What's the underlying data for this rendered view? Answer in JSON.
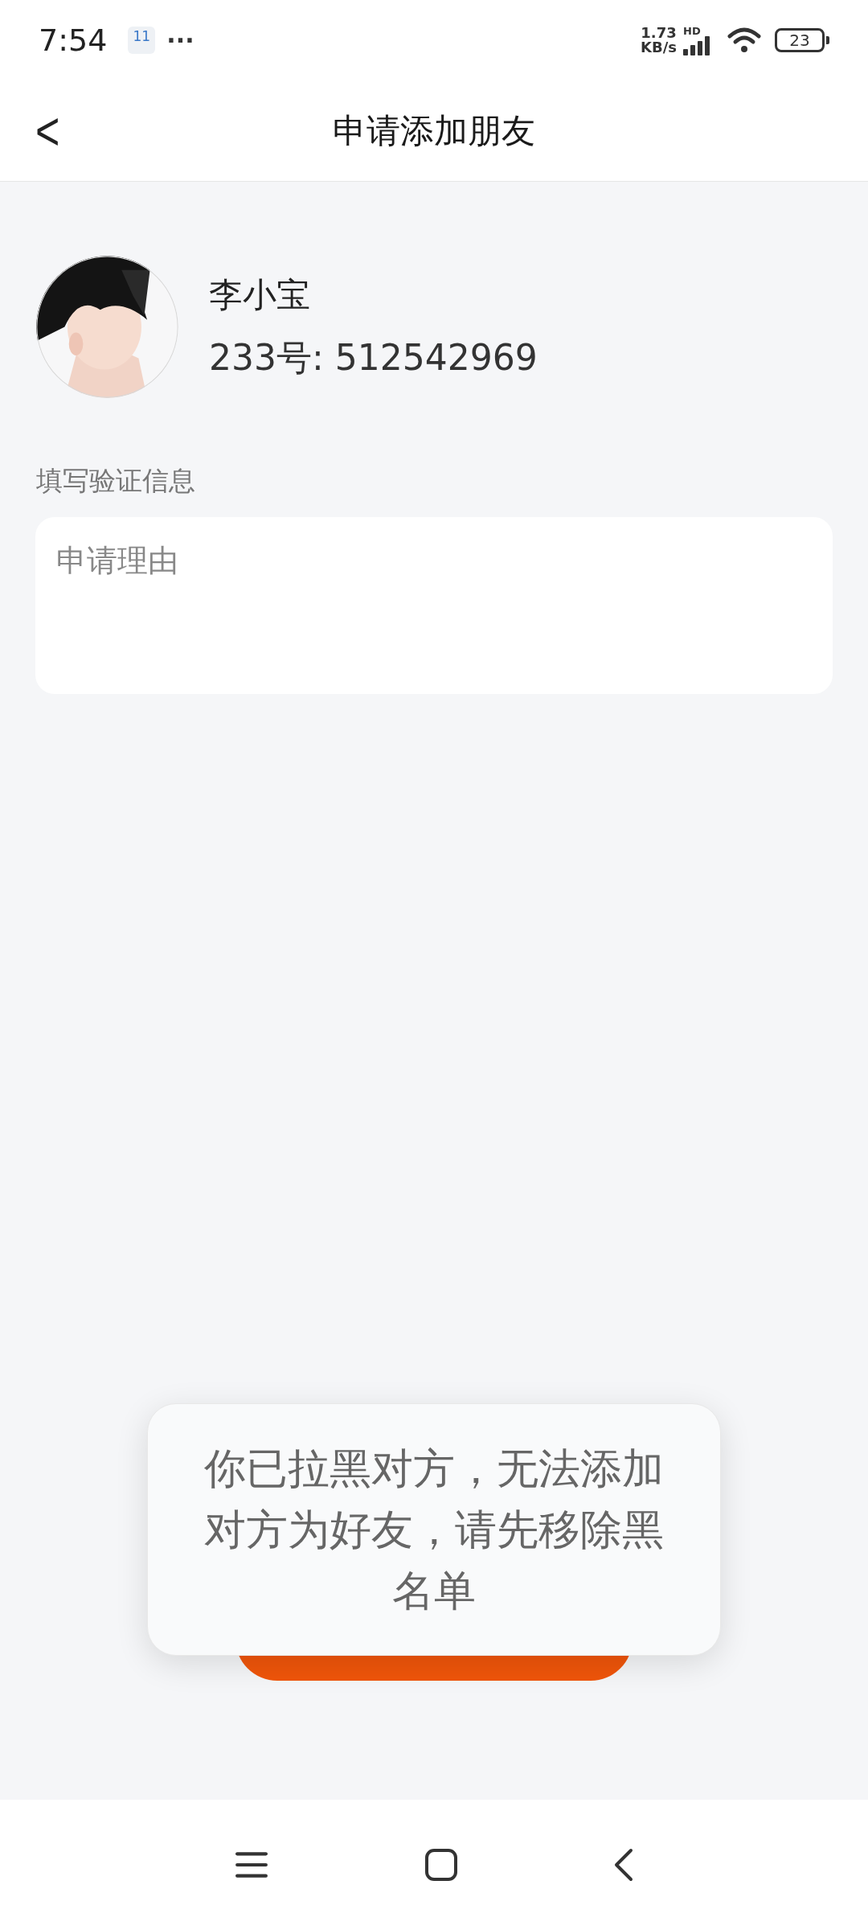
{
  "status_bar": {
    "time": "7:54",
    "calendar_day": "11",
    "more": "···",
    "speed_value": "1.73",
    "speed_unit": "KB/s",
    "network_tag": "HD",
    "battery": "23"
  },
  "header": {
    "back": "<",
    "title": "申请添加朋友"
  },
  "profile": {
    "name": "李小宝",
    "id_line": "233号: 512542969"
  },
  "verify": {
    "label": "填写验证信息",
    "field": {
      "placeholder": "申请理由"
    }
  },
  "send_button": {
    "kind": "primary"
  },
  "toast": {
    "message": "你已拉黑对方，无法添加对方为好友，请先移除黑名单"
  },
  "nav_bar": {
    "buttons": [
      {
        "kind": "menu"
      },
      {
        "kind": "home"
      },
      {
        "kind": "back"
      }
    ]
  }
}
